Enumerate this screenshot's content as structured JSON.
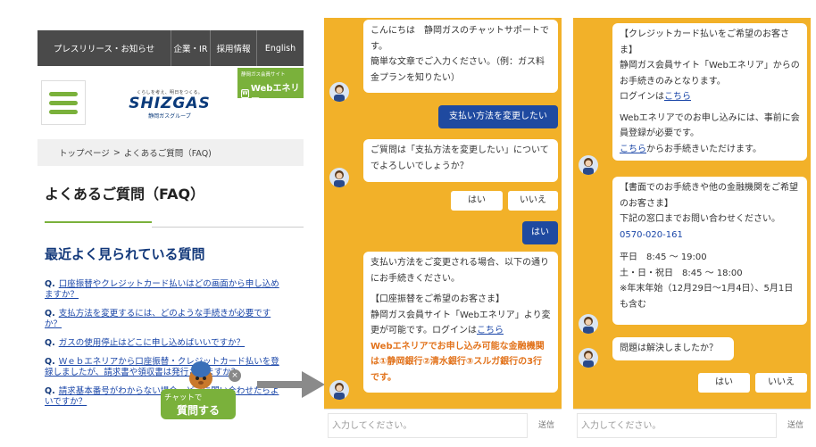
{
  "faq_page": {
    "nav": [
      "プレスリリース・お知らせ",
      "企業・IR",
      "採用情報",
      "English"
    ],
    "logo": {
      "tagline": "くらしを考え、明日をつくる。",
      "brand": "SHIZGAS",
      "group": "静岡ガスグループ"
    },
    "web_banner": {
      "top": "静岡ガス会員サイト",
      "name": "Webエネリア"
    },
    "breadcrumb": [
      "トップページ",
      ">",
      "よくあるご質問（FAQ)"
    ],
    "title": "よくあるご質問（FAQ）",
    "section_title": "最近よく見られている質問",
    "q_marker": "Q.",
    "faqs": [
      "口座振替やクレジットカード払いはどの画面から申し込めますか？",
      "支払方法を変更するには、どのような手続きが必要ですか？",
      "ガスの使用停止はどこに申し込めばいいですか？",
      "Ｗｅｂエネリアから口座振替・クレジットカード払いを登録しましたが、請求書や領収書は発行されますか？",
      "請求基本番号がわからない場合、どこに問い合わせたらよいですか？"
    ],
    "chat_button": {
      "line1": "チャットで",
      "line2": "質問する",
      "close": "×"
    }
  },
  "chat1": {
    "greeting": [
      "こんにちは　静岡ガスのチャットサポートです。",
      "簡単な文章でご入力ください。（例：ガス料金プランを知りたい）"
    ],
    "user_message": "支払い方法を変更したい",
    "confirm": "ご質問は「支払方法を変更したい」についてでよろしいでしょうか？",
    "options": [
      "はい",
      "いいえ"
    ],
    "user_reply": "はい",
    "answer": {
      "intro": "支払い方法をご変更される場合、以下の通りにお手続きください。",
      "heading": "【口座振替をご希望のお客さま】",
      "body_pre": "静岡ガス会員サイト「Webエネリア」より変更が可能です。ログインは",
      "link": "こちら",
      "orange": "Webエネリアでお申し込み可能な金融機関は①静岡銀行②清水銀行③スルガ銀行の3行です。"
    },
    "input_placeholder": "入力してください。",
    "send_label": "送信"
  },
  "chat2": {
    "card_msg": {
      "heading": "【クレジットカード払いをご希望のお客さま】",
      "body": "静岡ガス会員サイト「Webエネリア」からのお手続きのみとなります。",
      "login_pre": "ログインは",
      "login_link": "こちら",
      "note": "Webエネリアでのお申し込みには、事前に会員登録が必要です。",
      "reg_link": "こちら",
      "reg_post": "からお手続きいただけます。"
    },
    "paper_msg": {
      "heading": "【書面でのお手続きや他の金融機関をご希望のお客さま】",
      "body": "下記の窓口までお問い合わせください。",
      "phone": "0570-020-161",
      "hours": [
        "平日　8:45 〜 19:00",
        "土・日・祝日　8:45 〜 18:00",
        "※年末年始（12月29日〜1月4日）、5月1日も含む"
      ]
    },
    "resolved": "問題は解決しましたか？",
    "options": [
      "はい",
      "いいえ"
    ],
    "input_placeholder": "入力してください。",
    "send_label": "送信"
  },
  "colors": {
    "chat_bg": "#f2b129",
    "brand_green": "#7ab13b",
    "navy": "#1f4aa0",
    "orange_text": "#e2731c"
  }
}
